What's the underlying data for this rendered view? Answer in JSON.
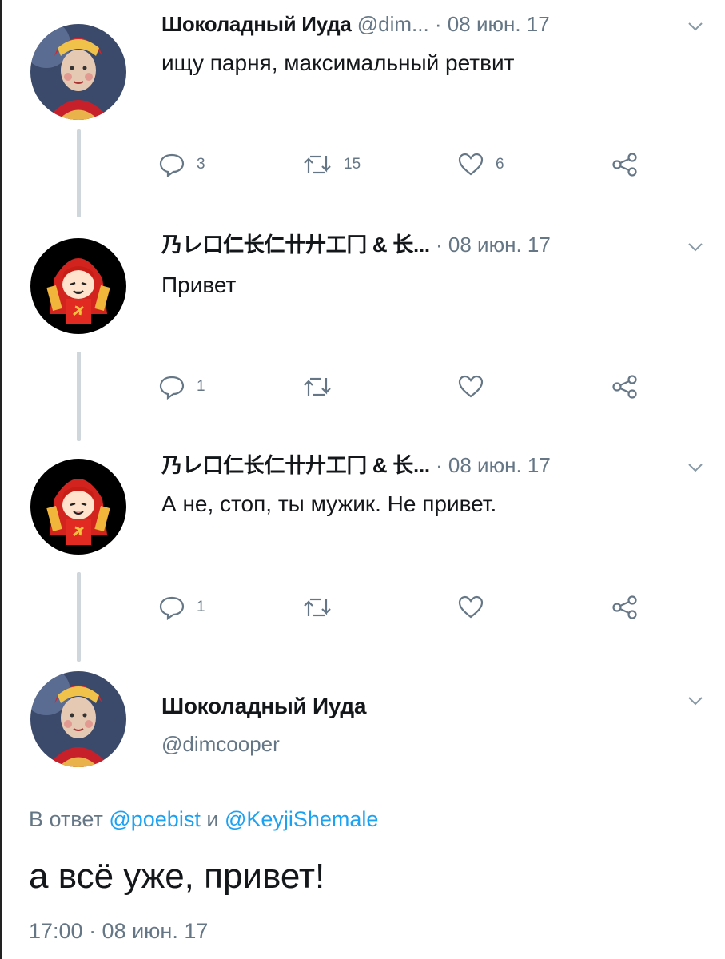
{
  "colors": {
    "text": "#14171a",
    "muted": "#657786",
    "link": "#1da1f2",
    "thread_line": "#cfd6dc"
  },
  "tweets": [
    {
      "name": "Шоколадный Иуда",
      "handle": "@dim...",
      "date": "· 08 июн. 17",
      "text": "ищу парня, максимальный ретвит",
      "replies": "3",
      "retweets": "15",
      "likes": "6"
    },
    {
      "name": "乃レ口仁长仁卄廾工冂 & 长...",
      "date": "· 08 июн. 17",
      "text": "Привет",
      "replies": "1",
      "retweets": "",
      "likes": ""
    },
    {
      "name": "乃レ口仁长仁卄廾工冂 & 长...",
      "date": "· 08 июн. 17",
      "text": "А не, стоп, ты мужик. Не привет.",
      "replies": "1",
      "retweets": "",
      "likes": ""
    }
  ],
  "main_tweet": {
    "name": "Шоколадный Иуда",
    "handle": "@dimcooper",
    "reply_prefix": "В ответ",
    "reply_user1": "@poebist",
    "reply_and": "и",
    "reply_user2": "@KeyjiShemale",
    "text": "а всё уже, привет!",
    "timestamp": "17:00 · 08 июн. 17"
  },
  "icons": {
    "reply": "reply-icon",
    "retweet": "retweet-icon",
    "like": "heart-icon",
    "share": "share-icon",
    "caret": "chevron-down-icon"
  }
}
